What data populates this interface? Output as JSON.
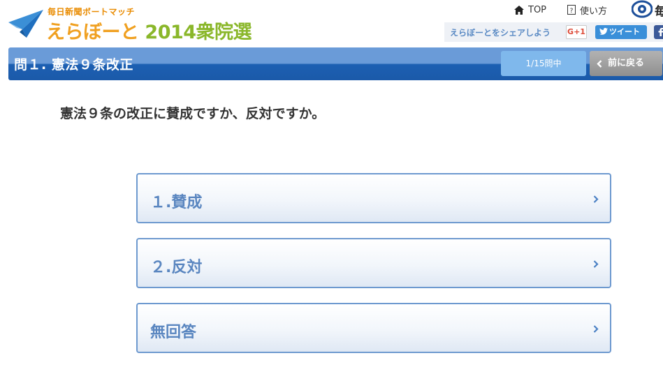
{
  "header": {
    "logo_sub": "毎日新聞ボートマッチ",
    "logo_main": "えらぼーと",
    "logo_year": "2014衆院選",
    "nav": [
      {
        "label": "TOP",
        "icon": "home-icon"
      },
      {
        "label": "使い方",
        "icon": "help-icon"
      }
    ],
    "nav_cut": "毎",
    "share": {
      "text": "えらぼーとをシェアしよう",
      "gplus": "G+1",
      "tweet": "ツイート"
    }
  },
  "question_bar": {
    "title": "問１. 憲法９条改正",
    "progress": "1/15問中",
    "back_label": "前に戻る"
  },
  "question": {
    "text": "憲法９条の改正に賛成ですか、反対ですか。"
  },
  "options": [
    {
      "label": "１.賛成"
    },
    {
      "label": "２.反対"
    },
    {
      "label": "無回答"
    }
  ],
  "colors": {
    "band_top": "#6a9bd8",
    "band_bottom": "#1b5aa9",
    "option_border": "#6d99cf",
    "option_text": "#5a86c0",
    "logo_orange": "#f0a020",
    "logo_green": "#8ab72a"
  }
}
